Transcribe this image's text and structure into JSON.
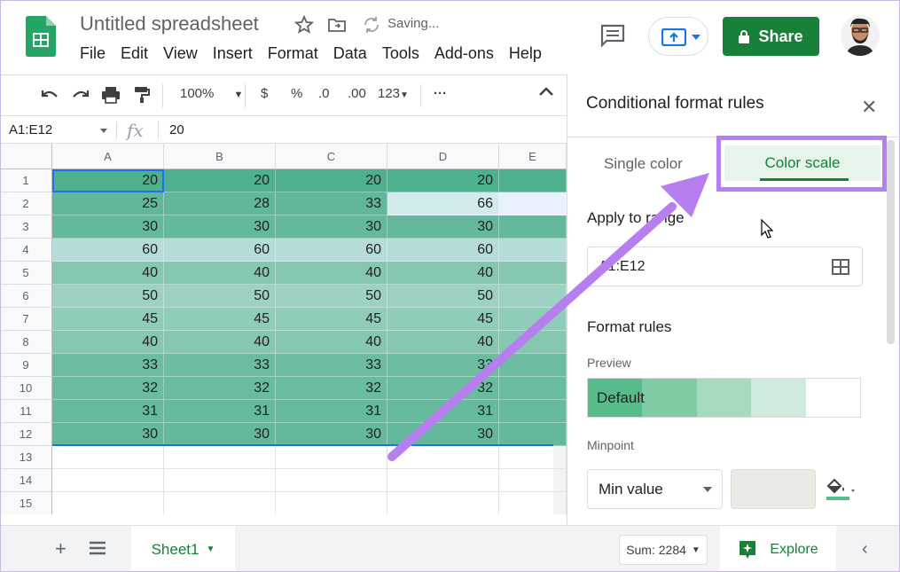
{
  "header": {
    "title": "Untitled spreadsheet",
    "saving_status": "Saving...",
    "menu": [
      "File",
      "Edit",
      "View",
      "Insert",
      "Format",
      "Data",
      "Tools",
      "Add-ons",
      "Help"
    ],
    "share_label": "Share",
    "brand_color": "#188038"
  },
  "toolbar": {
    "zoom": "100%",
    "currency": "$",
    "percent": "%",
    "decrease_decimal": ".0",
    "increase_decimal": ".00",
    "more_formats": "123",
    "more": "···"
  },
  "formula_bar": {
    "cell_ref": "A1:E12",
    "fx": "fx",
    "value": "20"
  },
  "grid": {
    "columns": [
      "A",
      "B",
      "C",
      "D",
      "E"
    ],
    "rows": [
      {
        "num": "1",
        "values": [
          "20",
          "20",
          "20",
          "20"
        ],
        "color": "#4fb08f"
      },
      {
        "num": "2",
        "values": [
          "25",
          "28",
          "33",
          "66"
        ],
        "color": "#62b79a"
      },
      {
        "num": "3",
        "values": [
          "30",
          "30",
          "30",
          "30"
        ],
        "color": "#64b99c"
      },
      {
        "num": "4",
        "values": [
          "60",
          "60",
          "60",
          "60"
        ],
        "color": "#b5dcd8"
      },
      {
        "num": "5",
        "values": [
          "40",
          "40",
          "40",
          "40"
        ],
        "color": "#86c7b1"
      },
      {
        "num": "6",
        "values": [
          "50",
          "50",
          "50",
          "50"
        ],
        "color": "#9dd1c4"
      },
      {
        "num": "7",
        "values": [
          "45",
          "45",
          "45",
          "45"
        ],
        "color": "#90ccba"
      },
      {
        "num": "8",
        "values": [
          "40",
          "40",
          "40",
          "40"
        ],
        "color": "#86c7b1"
      },
      {
        "num": "9",
        "values": [
          "33",
          "33",
          "33",
          "33"
        ],
        "color": "#6cbd9f"
      },
      {
        "num": "10",
        "values": [
          "32",
          "32",
          "32",
          "32"
        ],
        "color": "#69bc9e"
      },
      {
        "num": "11",
        "values": [
          "31",
          "31",
          "31",
          "31"
        ],
        "color": "#67bb9d"
      },
      {
        "num": "12",
        "values": [
          "30",
          "30",
          "30",
          "30"
        ],
        "color": "#64b99c"
      },
      {
        "num": "13",
        "values": [
          "",
          "",
          "",
          ""
        ],
        "color": ""
      },
      {
        "num": "14",
        "values": [
          "",
          "",
          "",
          ""
        ],
        "color": ""
      },
      {
        "num": "15",
        "values": [
          "",
          "",
          "",
          ""
        ],
        "color": ""
      }
    ]
  },
  "bottom": {
    "sheet_name": "Sheet1",
    "sum_label": "Sum: 2284",
    "explore_label": "Explore"
  },
  "panel": {
    "title": "Conditional format rules",
    "tab_single": "Single color",
    "tab_scale": "Color scale",
    "apply_label": "Apply to range",
    "range_value": "A1:E12",
    "format_rules_label": "Format rules",
    "preview_label": "Preview",
    "preview_text": "Default",
    "preview_colors": [
      "#57bb8a",
      "#7fcba2",
      "#a6dabd",
      "#d0ebdc",
      "#ffffff"
    ],
    "minpoint_label": "Minpoint",
    "minpoint_value": "Min value",
    "highlight_color": "#b77ef0"
  }
}
